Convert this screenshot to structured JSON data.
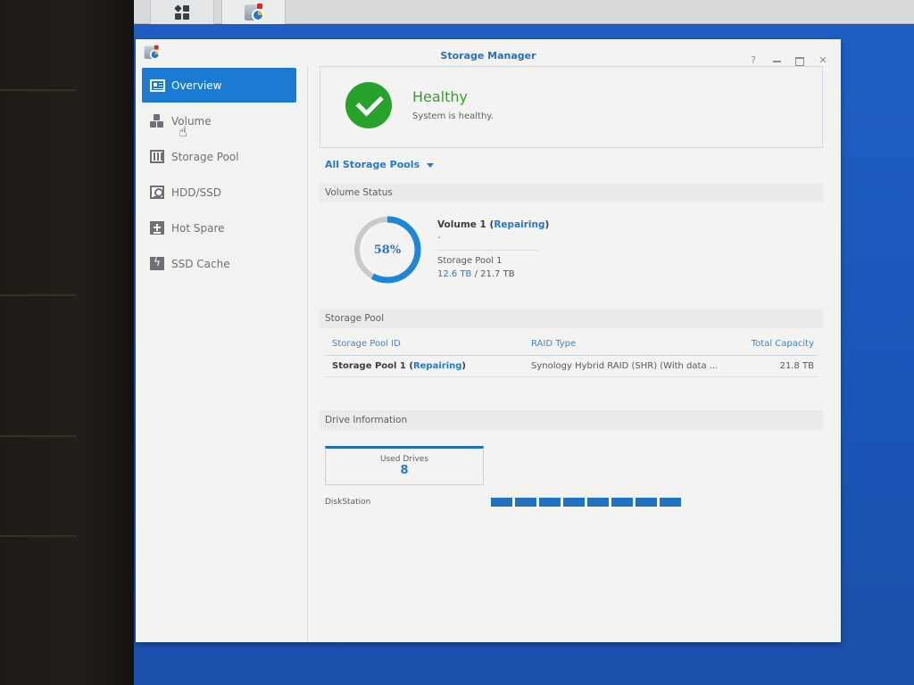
{
  "taskbar": {
    "buttons": [
      {
        "name": "main-menu",
        "icon": "grid-icon"
      },
      {
        "name": "storage-manager",
        "icon": "storage-manager-app-icon"
      }
    ]
  },
  "window": {
    "title": "Storage Manager",
    "controls": {
      "help": "?",
      "minimize": "minimize",
      "maximize": "maximize",
      "close": "✕"
    }
  },
  "sidebar": {
    "items": [
      {
        "label": "Overview",
        "icon": "overview-icon",
        "active": true
      },
      {
        "label": "Volume",
        "icon": "volume-icon",
        "active": false
      },
      {
        "label": "Storage Pool",
        "icon": "storage-pool-icon",
        "active": false
      },
      {
        "label": "HDD/SSD",
        "icon": "hdd-icon",
        "active": false
      },
      {
        "label": "Hot Spare",
        "icon": "hot-spare-icon",
        "active": false
      },
      {
        "label": "SSD Cache",
        "icon": "ssd-cache-icon",
        "active": false
      }
    ]
  },
  "health": {
    "status": "Healthy",
    "message": "System is healthy.",
    "color": "#27a22a"
  },
  "pool_filter": {
    "selected": "All Storage Pools"
  },
  "volume_status": {
    "heading": "Volume Status",
    "usage_percent": 58,
    "usage_label": "58%",
    "volume_name": "Volume 1",
    "volume_state": "Repairing",
    "description": "-",
    "pool": "Storage Pool 1",
    "used": "12.6 TB",
    "separator": " / ",
    "total": "21.7 TB"
  },
  "storage_pool": {
    "heading": "Storage Pool",
    "columns": [
      "Storage Pool ID",
      "RAID Type",
      "Total Capacity"
    ],
    "rows": [
      {
        "id": "Storage Pool 1",
        "state": "Repairing",
        "raid_type": "Synology Hybrid RAID (SHR) (With data ...",
        "capacity": "21.8 TB"
      }
    ]
  },
  "drive_info": {
    "heading": "Drive Information",
    "used_drives_label": "Used Drives",
    "used_drives": "8",
    "device": "DiskStation",
    "drive_slots": 8,
    "drive_color": "#1f72c4"
  },
  "colors": {
    "accent": "#1b7bd3",
    "link": "#2678c8",
    "desktop": "#1f5fc4"
  }
}
